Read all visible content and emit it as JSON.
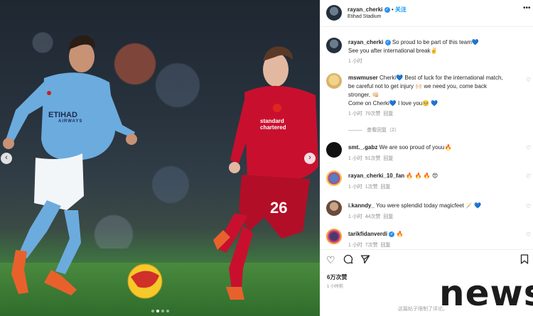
{
  "header": {
    "username": "rayan_cherki",
    "follow_label": "关注",
    "separator": "•",
    "location": "Etihad Stadium",
    "more_icon": "more-horizontal-icon"
  },
  "caption": {
    "username": "rayan_cherki",
    "text_line1": "So proud to be part of this team💙",
    "text_line2": "See you after international break✌️",
    "time": "1 小时"
  },
  "comments": [
    {
      "username": "mswmuser",
      "lines": [
        "Cherki💙 Best of luck for the international match,",
        "be careful not to get injury 🙌🏻 we need you, come back",
        "stronger, 👊🏻",
        "Come on Cherki💙 I love you🥺 💙"
      ],
      "time": "1 小时",
      "likes": "70次赞",
      "reply": "回复",
      "view_replies": "查看回复（2）"
    },
    {
      "username": "smt._.gabz",
      "text": "We are soo proud of youu🔥",
      "time": "1 小时",
      "likes": "91次赞",
      "reply": "回复"
    },
    {
      "username": "rayan_cherki_10_fan",
      "text": "🔥 🔥 🔥 😍",
      "time": "1 小时",
      "likes": "1次赞",
      "reply": "回复"
    },
    {
      "username": "i.kanndy_",
      "text": "You were splendid today magicfeet 🪄 💙",
      "time": "1 小时",
      "likes": "44次赞",
      "reply": "回复"
    },
    {
      "username": "tarikfidanverdi",
      "text": "🔥",
      "time": "1 小时",
      "likes": "7次赞",
      "reply": "回复"
    }
  ],
  "post": {
    "likes": "6万次赞",
    "time": "1 小时前",
    "comments_limited": "这篇帖子限制了评论。"
  },
  "watermark": "news",
  "colors": {
    "link_blue": "#0095f6",
    "verified_blue": "#2f8ff0",
    "city_sky_blue": "#6cabdd",
    "liverpool_red": "#c8102e"
  },
  "photo": {
    "jersey_text_left": "ETIHAD",
    "jersey_sub_left": "AIRWAYS",
    "jersey_text_right": "standard chartered",
    "jersey_number": "26"
  }
}
